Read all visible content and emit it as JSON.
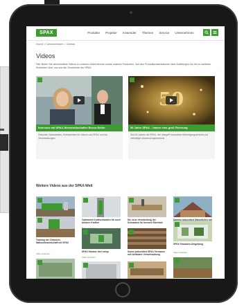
{
  "site": {
    "logo": "SPAX",
    "nav": [
      "Produkte",
      "Projekte",
      "Anwender",
      "Themen",
      "Service",
      "Unternehmen"
    ],
    "breadcrumb": "Home > Unternehmen > Videos"
  },
  "page": {
    "title": "Videos",
    "intro": "Hier finden Sie verschiedene Videos zu unseren Unternehmen sowie unseren Produkten. Von den Produktpräsentationen über Anleitungen bis hin zu weiteren Einblicken über uns und die Geschichte der SPAX."
  },
  "featured": [
    {
      "title": "Interview mit SPAX-Werbebotschafter Bruno Reiter",
      "desc": "Zwischen Stallarbeiten, Dreharbeiten für Videos und SPAX und bei Veranstaltungen."
    },
    {
      "title": "50 Jahre SPAX – Immer eins groß Fixierung",
      "desc": "Seit 50 Jahren die SPAX, der Inbegriff innovativer Befestigungstechnik und vielseitiger Anwendungsbereiche."
    }
  ],
  "more_title": "Weitere Videos aus der SPAX-Welt",
  "link_label": "Video ansehen",
  "videos": [
    {
      "title": "SPAX 4Cut"
    },
    {
      "title": "Optimierte Kraftschrauben für noch bessere Kraften"
    },
    {
      "title": "Die neue Verarbeitung der Schrauben für bessere Ebenheit"
    },
    {
      "title": "Dammu präsentiert Dämmtiefen mit SPAX"
    },
    {
      "title": "Training der Zimmerer-Nationalmannschaft mit SPAX"
    },
    {
      "title": "SPAX Kästner drei setup"
    },
    {
      "title": "Sonne präsentiert SPAX Terrassen mit sichtbarer Verschraubung"
    },
    {
      "title": "SPAX Fassaden-Umgebung"
    },
    {
      "title": ""
    },
    {
      "title": ""
    },
    {
      "title": ""
    },
    {
      "title": ""
    }
  ],
  "colors": {
    "accent": "#3f9a34",
    "frame": "#181818"
  }
}
